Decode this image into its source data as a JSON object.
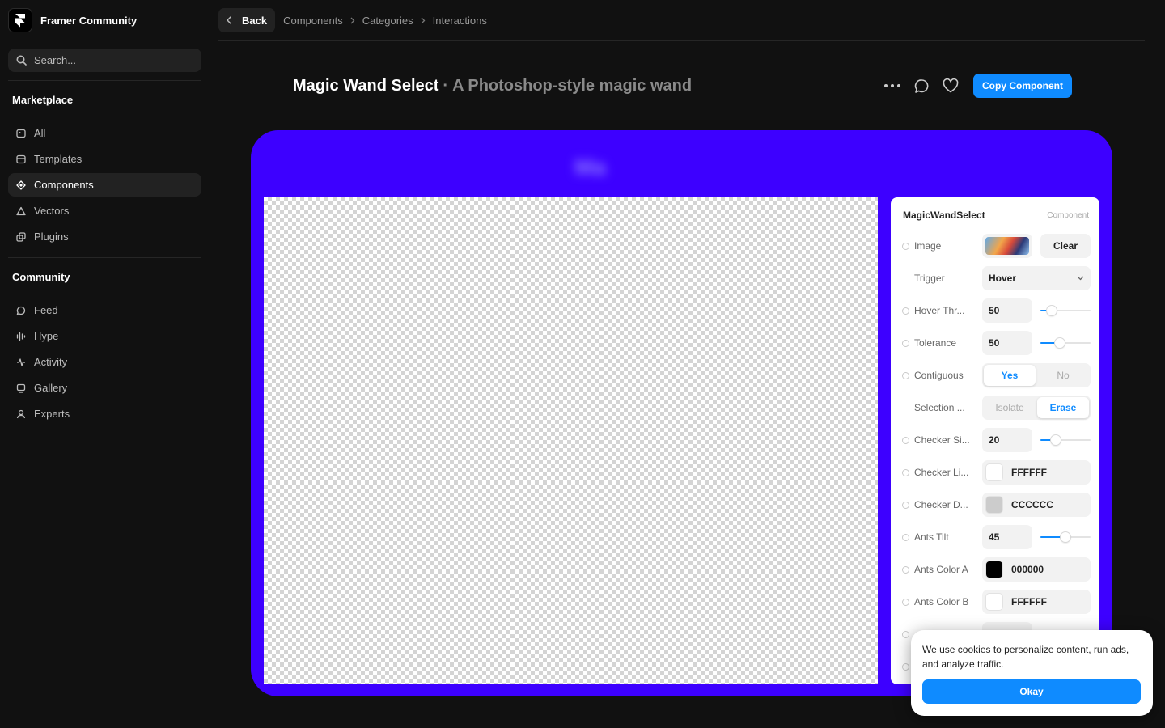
{
  "brand": {
    "name": "Framer Community"
  },
  "search": {
    "placeholder": "Search..."
  },
  "sidebar": {
    "marketplace_title": "Marketplace",
    "marketplace_items": [
      {
        "label": "All",
        "icon": "image-icon"
      },
      {
        "label": "Templates",
        "icon": "template-icon"
      },
      {
        "label": "Components",
        "icon": "component-icon",
        "active": true
      },
      {
        "label": "Vectors",
        "icon": "vector-icon"
      },
      {
        "label": "Plugins",
        "icon": "plugin-icon"
      }
    ],
    "community_title": "Community",
    "community_items": [
      {
        "label": "Feed",
        "icon": "chat-icon"
      },
      {
        "label": "Hype",
        "icon": "bars-icon"
      },
      {
        "label": "Activity",
        "icon": "pulse-icon"
      },
      {
        "label": "Gallery",
        "icon": "gallery-icon"
      },
      {
        "label": "Experts",
        "icon": "person-icon"
      }
    ]
  },
  "topbar": {
    "back_label": "Back",
    "breadcrumbs": [
      "Components",
      "Categories",
      "Interactions"
    ]
  },
  "header": {
    "title": "Magic Wand Select",
    "separator": "·",
    "subtitle": "A Photoshop-style magic wand",
    "copy_label": "Copy Component"
  },
  "panel": {
    "title": "MagicWandSelect",
    "tag": "Component",
    "image": {
      "label": "Image",
      "clear_label": "Clear"
    },
    "trigger": {
      "label": "Trigger",
      "value": "Hover"
    },
    "hover_threshold": {
      "label": "Hover Thr...",
      "value": "50",
      "level": 0.15
    },
    "tolerance": {
      "label": "Tolerance",
      "value": "50",
      "level": 0.35
    },
    "contiguous": {
      "label": "Contiguous",
      "options": [
        "Yes",
        "No"
      ],
      "selected": "Yes"
    },
    "selection": {
      "label": "Selection ...",
      "options": [
        "Isolate",
        "Erase"
      ],
      "selected": "Erase"
    },
    "checker_size": {
      "label": "Checker Si...",
      "value": "20",
      "level": 0.25
    },
    "checker_light": {
      "label": "Checker Li...",
      "value": "FFFFFF",
      "color": "#FFFFFF"
    },
    "checker_dark": {
      "label": "Checker D...",
      "value": "CCCCCC",
      "color": "#CCCCCC"
    },
    "ants_tilt": {
      "label": "Ants Tilt",
      "value": "45",
      "level": 0.5
    },
    "ants_color_a": {
      "label": "Ants Color A",
      "value": "000000",
      "color": "#000000"
    },
    "ants_color_b": {
      "label": "Ants Color B",
      "value": "FFFFFF",
      "color": "#FFFFFF"
    }
  },
  "cookie": {
    "text": "We use cookies to personalize content, run ads, and analyze traffic.",
    "button": "Okay"
  },
  "colors": {
    "accent": "#0F8BFF",
    "preview_bg": "#3D00FF"
  }
}
